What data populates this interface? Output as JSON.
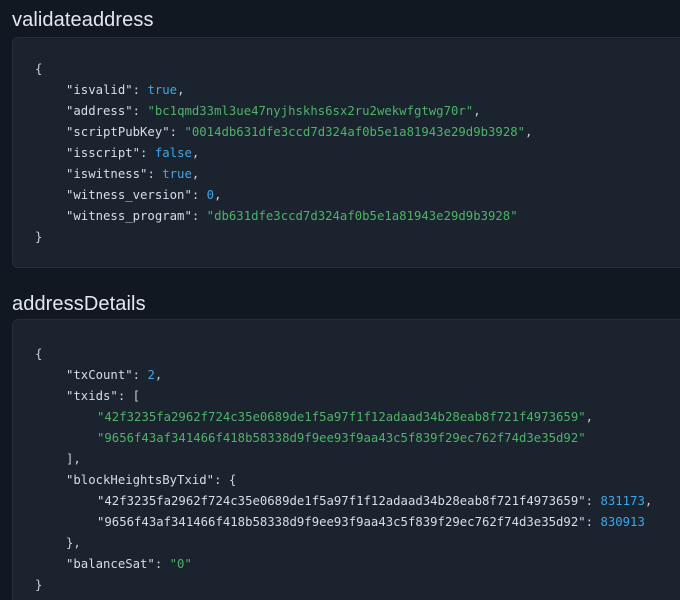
{
  "sections": [
    {
      "title": "validateaddress",
      "lines": [
        {
          "indent": 0,
          "parts": [
            {
              "t": "p",
              "v": "{"
            }
          ]
        },
        {
          "indent": 1,
          "parts": [
            {
              "t": "k",
              "v": "\"isvalid\""
            },
            {
              "t": "p",
              "v": ": "
            },
            {
              "t": "kw",
              "v": "true"
            },
            {
              "t": "p",
              "v": ","
            }
          ]
        },
        {
          "indent": 1,
          "parts": [
            {
              "t": "k",
              "v": "\"address\""
            },
            {
              "t": "p",
              "v": ": "
            },
            {
              "t": "s",
              "v": "\"bc1qmd33ml3ue47nyjhskhs6sx2ru2wekwfgtwg70r\""
            },
            {
              "t": "p",
              "v": ","
            }
          ]
        },
        {
          "indent": 1,
          "parts": [
            {
              "t": "k",
              "v": "\"scriptPubKey\""
            },
            {
              "t": "p",
              "v": ": "
            },
            {
              "t": "s",
              "v": "\"0014db631dfe3ccd7d324af0b5e1a81943e29d9b3928\""
            },
            {
              "t": "p",
              "v": ","
            }
          ]
        },
        {
          "indent": 1,
          "parts": [
            {
              "t": "k",
              "v": "\"isscript\""
            },
            {
              "t": "p",
              "v": ": "
            },
            {
              "t": "kw",
              "v": "false"
            },
            {
              "t": "p",
              "v": ","
            }
          ]
        },
        {
          "indent": 1,
          "parts": [
            {
              "t": "k",
              "v": "\"iswitness\""
            },
            {
              "t": "p",
              "v": ": "
            },
            {
              "t": "kw",
              "v": "true"
            },
            {
              "t": "p",
              "v": ","
            }
          ]
        },
        {
          "indent": 1,
          "parts": [
            {
              "t": "k",
              "v": "\"witness_version\""
            },
            {
              "t": "p",
              "v": ": "
            },
            {
              "t": "n",
              "v": "0"
            },
            {
              "t": "p",
              "v": ","
            }
          ]
        },
        {
          "indent": 1,
          "parts": [
            {
              "t": "k",
              "v": "\"witness_program\""
            },
            {
              "t": "p",
              "v": ": "
            },
            {
              "t": "s",
              "v": "\"db631dfe3ccd7d324af0b5e1a81943e29d9b3928\""
            }
          ]
        },
        {
          "indent": 0,
          "parts": [
            {
              "t": "p",
              "v": "}"
            }
          ]
        }
      ]
    },
    {
      "title": "addressDetails",
      "lines": [
        {
          "indent": 0,
          "parts": [
            {
              "t": "p",
              "v": "{"
            }
          ]
        },
        {
          "indent": 1,
          "parts": [
            {
              "t": "k",
              "v": "\"txCount\""
            },
            {
              "t": "p",
              "v": ": "
            },
            {
              "t": "n",
              "v": "2"
            },
            {
              "t": "p",
              "v": ","
            }
          ]
        },
        {
          "indent": 1,
          "parts": [
            {
              "t": "k",
              "v": "\"txids\""
            },
            {
              "t": "p",
              "v": ": ["
            }
          ]
        },
        {
          "indent": 2,
          "parts": [
            {
              "t": "s",
              "v": "\"42f3235fa2962f724c35e0689de1f5a97f1f12adaad34b28eab8f721f4973659\""
            },
            {
              "t": "p",
              "v": ","
            }
          ]
        },
        {
          "indent": 2,
          "parts": [
            {
              "t": "s",
              "v": "\"9656f43af341466f418b58338d9f9ee93f9aa43c5f839f29ec762f74d3e35d92\""
            }
          ]
        },
        {
          "indent": 1,
          "parts": [
            {
              "t": "p",
              "v": "],"
            }
          ]
        },
        {
          "indent": 1,
          "parts": [
            {
              "t": "k",
              "v": "\"blockHeightsByTxid\""
            },
            {
              "t": "p",
              "v": ": {"
            }
          ]
        },
        {
          "indent": 2,
          "parts": [
            {
              "t": "k",
              "v": "\"42f3235fa2962f724c35e0689de1f5a97f1f12adaad34b28eab8f721f4973659\""
            },
            {
              "t": "p",
              "v": ": "
            },
            {
              "t": "n",
              "v": "831173"
            },
            {
              "t": "p",
              "v": ","
            }
          ]
        },
        {
          "indent": 2,
          "parts": [
            {
              "t": "k",
              "v": "\"9656f43af341466f418b58338d9f9ee93f9aa43c5f839f29ec762f74d3e35d92\""
            },
            {
              "t": "p",
              "v": ": "
            },
            {
              "t": "n",
              "v": "830913"
            }
          ]
        },
        {
          "indent": 1,
          "parts": [
            {
              "t": "p",
              "v": "},"
            }
          ]
        },
        {
          "indent": 1,
          "parts": [
            {
              "t": "k",
              "v": "\"balanceSat\""
            },
            {
              "t": "p",
              "v": ": "
            },
            {
              "t": "s",
              "v": "\"0\""
            }
          ]
        },
        {
          "indent": 0,
          "parts": [
            {
              "t": "p",
              "v": "}"
            }
          ]
        }
      ]
    }
  ],
  "colors": {
    "background": "#111821",
    "panel": "#1a232e",
    "string": "#4fb26a",
    "keyword_number": "#3fa6e8",
    "key": "#d6dde5"
  }
}
